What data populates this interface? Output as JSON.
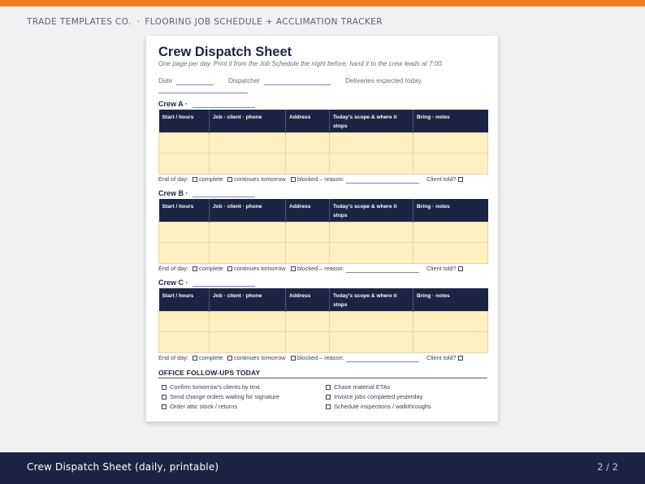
{
  "header": {
    "brand": "TRADE TEMPLATES CO.",
    "separator": "·",
    "section": "FLOORING JOB SCHEDULE + ACCLIMATION TRACKER"
  },
  "sheet": {
    "title": "Crew Dispatch Sheet",
    "subtitle": "One page per day. Print it from the Job Schedule the night before, hand it to the crew leads at 7:00.",
    "date_label": "Date",
    "dispatcher_label": "Dispatcher",
    "deliveries_label": "Deliveries expected today"
  },
  "table_columns": [
    "Start / hours",
    "Job · client · phone",
    "Address",
    "Today's scope & where it stops",
    "Bring · notes"
  ],
  "end_of_day": {
    "label": "End of day:",
    "complete": "complete",
    "continues": "continues tomorrow",
    "blocked": "blocked – reason:",
    "client_told": "Client told?"
  },
  "crews": [
    {
      "label": "Crew A  ·"
    },
    {
      "label": "Crew B  ·"
    },
    {
      "label": "Crew C  ·"
    }
  ],
  "office": {
    "title": "OFFICE FOLLOW-UPS TODAY",
    "left_items": [
      "Confirm tomorrow's clients by text",
      "Send change orders waiting for signature",
      "Order attic stock / returns"
    ],
    "right_items": [
      "Chase material ETAs",
      "Invoice jobs completed yesterday",
      "Schedule inspections / walkthroughs"
    ]
  },
  "footer": {
    "title": "Crew Dispatch Sheet (daily, printable)",
    "page": "2 / 2"
  },
  "colors": {
    "accent": "#ed7d23",
    "navy": "#1c2443",
    "cell_fill": "#fff0c2",
    "line": "#7b82d8"
  }
}
